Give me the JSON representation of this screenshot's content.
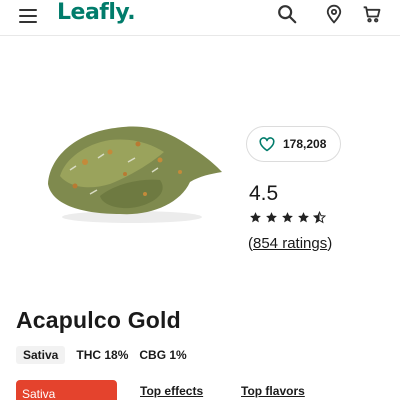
{
  "header": {
    "logo_text": "Leafly.",
    "icons": [
      "menu-icon",
      "search-icon",
      "location-pin-icon",
      "cart-icon"
    ],
    "brand_color": "#017c6b"
  },
  "favorites": {
    "icon": "heart-outline-icon",
    "count": "178,208"
  },
  "rating": {
    "value": "4.5",
    "stars": 4.5,
    "count_open": "(",
    "count_text": "854 ratings",
    "count_close": ")"
  },
  "strain": {
    "name": "Acapulco Gold",
    "type": "Sativa",
    "thc": "THC 18%",
    "cbg": "CBG 1%"
  },
  "tabs": {
    "active_label": "Sativa",
    "active_color": "#e4432d",
    "effects_label": "Top effects",
    "flavors_label": "Top flavors"
  }
}
